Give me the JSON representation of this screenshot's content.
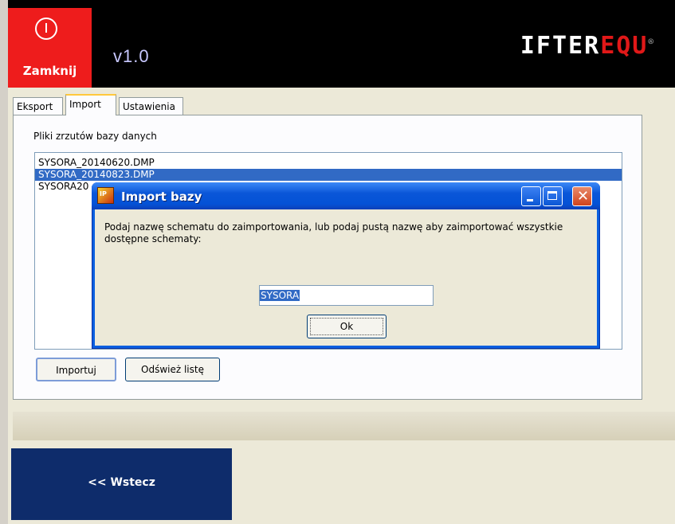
{
  "header": {
    "close_label": "Zamknij",
    "version": "v1.0",
    "logo_white": "IFTER",
    "logo_red": "EQU",
    "logo_mark": "®"
  },
  "tabs": [
    {
      "label": "Eksport",
      "active": false
    },
    {
      "label": "Import",
      "active": true
    },
    {
      "label": "Ustawienia",
      "active": false
    }
  ],
  "import_panel": {
    "list_label": "Pliki zrzutów bazy danych",
    "files": [
      {
        "name": "SYSORA_20140620.DMP",
        "selected": false
      },
      {
        "name": "SYSORA_20140823.DMP",
        "selected": true
      },
      {
        "name": "SYSORA20",
        "selected": false
      }
    ],
    "import_button": "Importuj",
    "refresh_button": "Odśwież listę"
  },
  "footer": {
    "back_button": "<< Wstecz"
  },
  "dialog": {
    "title": "Import bazy",
    "message": "Podaj nazwę schematu do zaimportowania, lub podaj pustą nazwę aby zaimportować wszystkie dostępne schematy:",
    "input_value": "SYSORA",
    "ok_button": "Ok",
    "close_glyph": "✕"
  },
  "colors": {
    "close_tile": "#ee1c1c",
    "back_tile": "#0e2c6b",
    "selection": "#316ac5",
    "dialog_title": "#0a56d8"
  }
}
